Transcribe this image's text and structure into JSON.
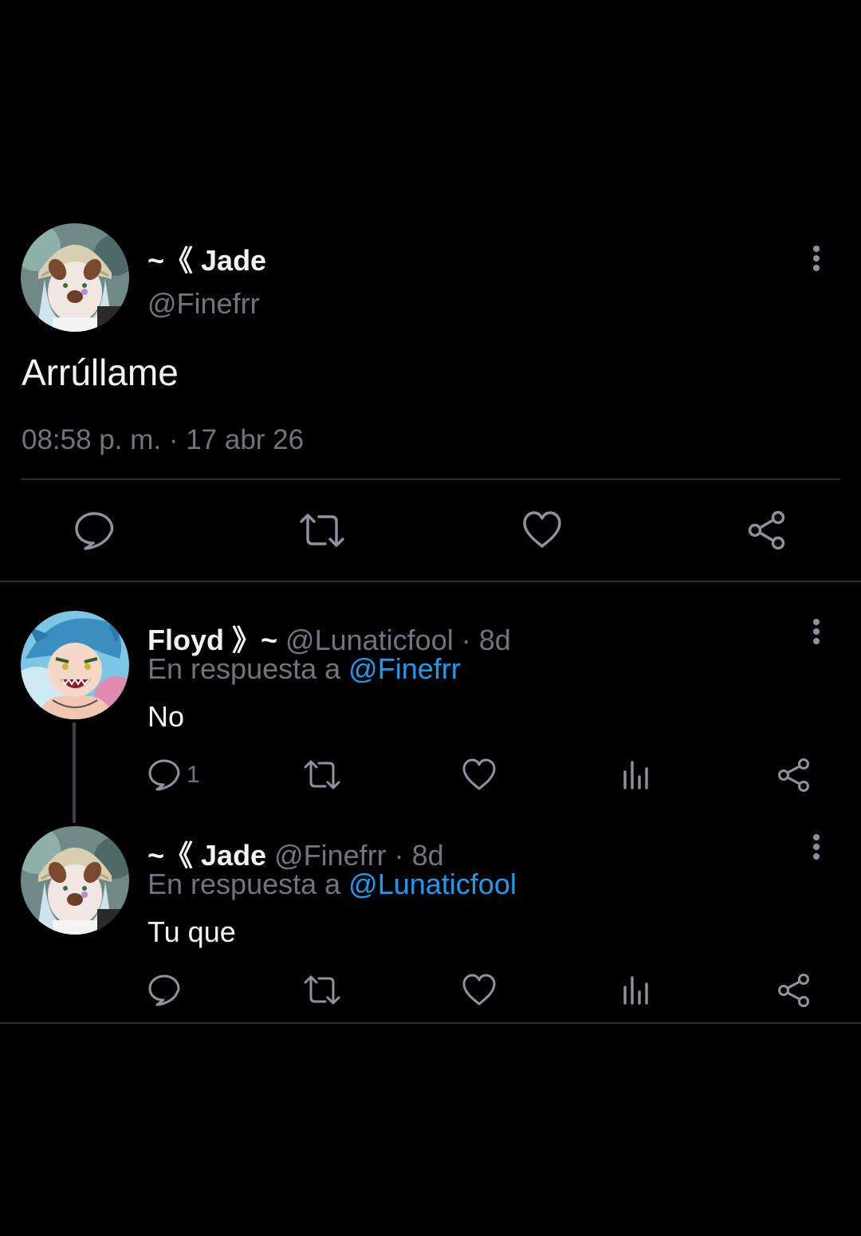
{
  "main_tweet": {
    "display_name": "~《 Jade",
    "handle": "@Finefrr",
    "text": "Arrúllame",
    "timestamp": "08:58 p. m. · 17 abr 26",
    "actions": [
      "reply-icon",
      "retweet-icon",
      "like-icon",
      "share-icon"
    ]
  },
  "replies": [
    {
      "display_name": "Floyd 》~",
      "handle_time": "@Lunaticfool · 8d",
      "reply_prefix": "En respuesta a",
      "reply_to": "@Finefrr",
      "text": "No",
      "reply_count": "1",
      "actions": [
        "reply-icon",
        "retweet-icon",
        "like-icon",
        "views-icon",
        "share-icon"
      ]
    },
    {
      "display_name": "~《 Jade",
      "handle_time": "@Finefrr · 8d",
      "reply_prefix": "En respuesta a",
      "reply_to": "@Lunaticfool",
      "text": "Tu que",
      "reply_count": "",
      "actions": [
        "reply-icon",
        "retweet-icon",
        "like-icon",
        "views-icon",
        "share-icon"
      ]
    }
  ],
  "colors": {
    "background": "#000000",
    "text_primary": "#f2f2f2",
    "text_secondary": "#6e767d",
    "link": "#1d9bf0",
    "divider": "#2a2d31"
  }
}
